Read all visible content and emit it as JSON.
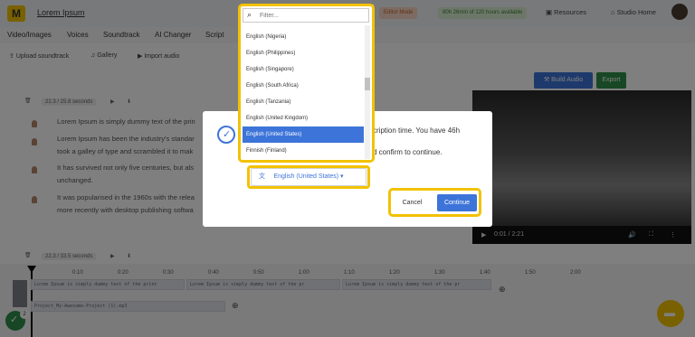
{
  "topbar": {
    "logo_text": "M",
    "title": "Lorem Ipsum",
    "editor_mode": "Editor Mode",
    "time_available": "80h 26min of 120 hours available",
    "resources": "Resources",
    "studio_home": "Studio Home"
  },
  "menu": {
    "items": [
      "Video/Images",
      "Voices",
      "Soundtrack",
      "AI Changer",
      "Script"
    ]
  },
  "toolbar": {
    "upload_soundtrack": "Upload soundtrack",
    "gallery": "Gallery",
    "import_audio": "Import audio"
  },
  "editor": {
    "segment1_info": "22.3 / 25.8 seconds",
    "segment2_info": "22.3 / 33.5 seconds",
    "paragraphs": [
      "Lorem Ipsum is simply dummy text of the prin",
      "Lorem Ipsum has been the industry's standar",
      "took a galley of type and scrambled it to mak",
      "It has survived not only five centuries, but als",
      "unchanged.",
      "It was popularised in the 1960s with the relea",
      "more recently with desktop publishing softwa"
    ]
  },
  "right": {
    "build_audio": "Build Audio",
    "export": "Export",
    "video_time": "0:01 / 2:21"
  },
  "timeline": {
    "ticks": [
      "0:10",
      "0:20",
      "0:30",
      "0:40",
      "0:50",
      "1:00",
      "1:10",
      "1:20",
      "1:30",
      "1:40",
      "1:50",
      "2:00"
    ],
    "track1": "Lorem Ipsum is simply dummy text of the print",
    "track1b": "Lorem Ipsum is simply dummy text of the pr",
    "track1c": "Lorem Ipsum is simply dummy text of the pr",
    "track2": "Project_My-Awesome-Project (1).mp3"
  },
  "modal": {
    "text1": "cription time. You have 46h",
    "text2": "d confirm to continue.",
    "selected_language": "English (United States)",
    "cancel": "Cancel",
    "continue": "Continue"
  },
  "dropdown": {
    "placeholder": "Filter...",
    "items": [
      "English (Nigeria)",
      "English (Philippines)",
      "English (Singapore)",
      "English (South Africa)",
      "English (Tanzania)",
      "English (United Kingdom)",
      "English (United States)",
      "Finnish (Finland)"
    ],
    "selected_index": 6
  },
  "badge": {
    "count": "2"
  },
  "colors": {
    "accent": "#3d74d9",
    "highlight": "#f2c200",
    "success": "#2f8f49"
  }
}
